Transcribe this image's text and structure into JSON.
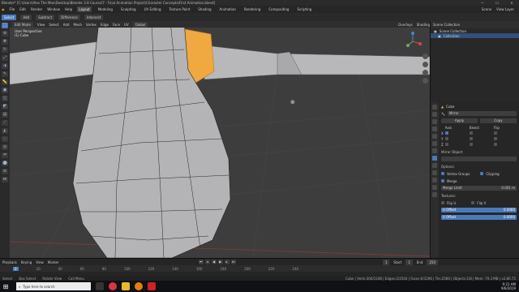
{
  "window": {
    "title": "Blender* [C:\\Users\\Alex The Man\\Desktop\\Blender 2.8 Course\\7 - Final Animation Project\\Character Concepts\\First Animation.blend]",
    "controls": [
      "—",
      "☐",
      "✕"
    ]
  },
  "topbar": {
    "menus": [
      "File",
      "Edit",
      "Render",
      "Window",
      "Help"
    ],
    "workspaces": [
      "Layout",
      "Modeling",
      "Sculpting",
      "UV Editing",
      "Texture Paint",
      "Shading",
      "Animation",
      "Rendering",
      "Compositing",
      "Scripting"
    ],
    "active_workspace": "Layout",
    "scene": "Scene",
    "view_layer": "View Layer"
  },
  "toolrow": {
    "buttons": [
      "Select",
      "Add",
      "Subtract",
      "Difference",
      "Intersect"
    ],
    "active": "Select",
    "transform": "Global"
  },
  "viewport": {
    "mode": "Edit Mode",
    "menus": [
      "View",
      "Select",
      "Add",
      "Mesh",
      "Vertex",
      "Edge",
      "Face",
      "UV"
    ],
    "transform": "Global",
    "right": [
      "Overlays",
      "Shading"
    ],
    "info_line1": "User Perspective",
    "info_line2": "(1) Cube",
    "colors": {
      "mesh": "#b4b4b6",
      "selected": "#f0a840",
      "background": "#3d3d3d"
    }
  },
  "outliner": {
    "title": "Scene Collection",
    "rows": [
      "Scene Collection",
      "Collection"
    ]
  },
  "properties": {
    "object": "Cube",
    "modifier_name": "Mirror",
    "apply_label": "Apply",
    "copy_label": "Copy",
    "axis_headers": [
      "Axis",
      "Bisect",
      "Flip"
    ],
    "axes": [
      "X",
      "Y",
      "Z"
    ],
    "mirror_object_label": "Mirror Object:",
    "options_label": "Options:",
    "merge_label": "Merge",
    "clipping_label": "Clipping",
    "vertex_groups_label": "Vertex Groups",
    "merge_limit_label": "Merge Limit",
    "merge_limit_value": "0.001 m",
    "textures_label": "Textures:",
    "flip_u": "Flip U",
    "flip_v": "Flip V",
    "u_offset_label": "U Offset",
    "u_offset_value": "0.0000",
    "v_offset_label": "V Offset",
    "v_offset_value": "0.0000"
  },
  "timeline": {
    "menus": [
      "Playback",
      "Keying",
      "View",
      "Marker"
    ],
    "current_frame": "1",
    "start_label": "Start",
    "start": "1",
    "end_label": "End",
    "end": "250",
    "ruler": [
      "0",
      "20",
      "40",
      "60",
      "80",
      "100",
      "120",
      "140",
      "160",
      "180",
      "200",
      "220",
      "240"
    ]
  },
  "statusbar": {
    "left": [
      "Select",
      "Box Select",
      "Rotate View",
      "Call Menu"
    ],
    "right": "Cube | Verts:304/1248 | Edges:2/2544 | Faces:0/1296 | Tris:2580 | Objects:1/8 | Mem: 79.3 MB | v2.80.75"
  },
  "taskbar": {
    "search_placeholder": "Type here to search",
    "time": "9:21 AM",
    "date": "9/6/2019"
  }
}
